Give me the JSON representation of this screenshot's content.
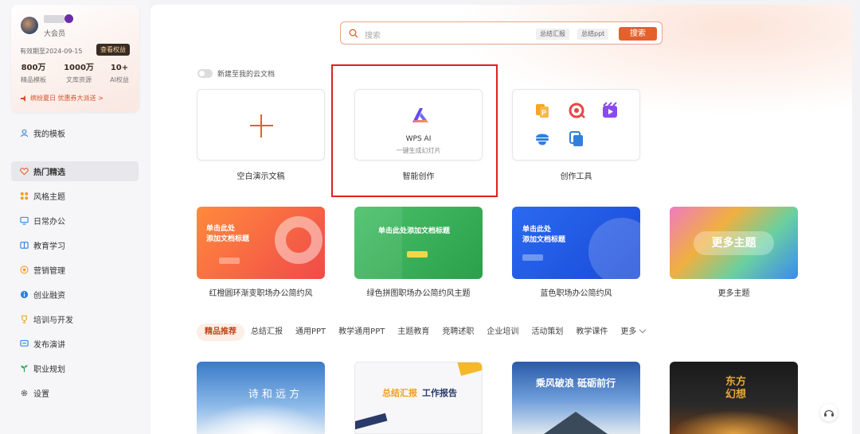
{
  "sidebar": {
    "user": {
      "member_level": "大会员",
      "validity": "有效期至2024-09-15",
      "rights_button": "查看权益",
      "stats": [
        {
          "value": "800万",
          "label": "精品模板"
        },
        {
          "value": "1000万",
          "label": "文库资源"
        },
        {
          "value": "10+",
          "label": "AI权益"
        }
      ],
      "promo": "缤纷夏日 优惠券大派送 >"
    },
    "nav": [
      {
        "label": "我的模板",
        "icon": "user-icon"
      },
      {
        "label": "热门精选",
        "icon": "heart-icon"
      },
      {
        "label": "风格主题",
        "icon": "grid-icon"
      },
      {
        "label": "日常办公",
        "icon": "monitor-icon"
      },
      {
        "label": "教育学习",
        "icon": "book-icon"
      },
      {
        "label": "营销管理",
        "icon": "target-icon"
      },
      {
        "label": "创业融资",
        "icon": "info-icon"
      },
      {
        "label": "培训与开发",
        "icon": "trophy-icon"
      },
      {
        "label": "发布演讲",
        "icon": "chat-icon"
      },
      {
        "label": "职业规划",
        "icon": "plant-icon"
      },
      {
        "label": "设置",
        "icon": "gear-icon"
      }
    ]
  },
  "main": {
    "search": {
      "placeholder": "搜索",
      "tags": [
        "总结汇报",
        "总结ppt"
      ],
      "button": "搜索"
    },
    "cloud_toggle": {
      "label": "新建至我的云文档"
    },
    "create": {
      "blank": "空白演示文稿",
      "ai_card_title": "WPS AI",
      "ai_card_subtitle": "一键生成幻灯片",
      "ai": "智能创作",
      "tools": "创作工具"
    },
    "themes": [
      {
        "caption": "红橙圆环渐变职场办公简约风",
        "title_line1": "单击此处",
        "title_line2": "添加文档标题"
      },
      {
        "caption": "绿色拼图职场办公简约风主题",
        "title_line1": "单击此处添加文档标题"
      },
      {
        "caption": "蓝色职场办公简约风",
        "title_line1": "单击此处",
        "title_line2": "添加文档标题"
      },
      {
        "caption": "更多主题",
        "button": "更多主题"
      }
    ],
    "categories": [
      "精品推荐",
      "总结汇报",
      "通用PPT",
      "教学通用PPT",
      "主题教育",
      "竞聘述职",
      "企业培训",
      "活动策划",
      "教学课件",
      "更多"
    ],
    "thumbs": [
      {
        "text": "诗 和 远 方"
      },
      {
        "text_a": "总结汇报",
        "text_b": "工作报告"
      },
      {
        "text": "乘风破浪 砥砺前行"
      },
      {
        "text": "东方幻想"
      }
    ]
  },
  "colors": {
    "accent": "#e5602b",
    "highlight": "#e02020"
  }
}
